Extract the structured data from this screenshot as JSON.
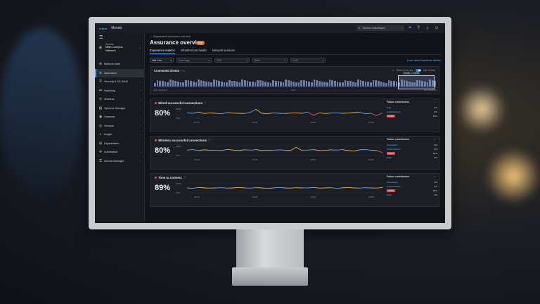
{
  "topbar": {
    "logo": "cisco",
    "app_name": "Meraki",
    "search_placeholder": "Search Dashboard",
    "icons": [
      "sparkle-icon",
      "help-icon",
      "bell-icon",
      "user-icon"
    ]
  },
  "sidebar": {
    "network_label": "Network",
    "network_value": "Main Campus Network",
    "items": [
      {
        "label": "Network-wide",
        "icon": "network-icon"
      },
      {
        "label": "Assurance",
        "icon": "assurance-icon",
        "active": true
      },
      {
        "label": "Security & SD-WAN",
        "icon": "security-icon"
      },
      {
        "label": "Switching",
        "icon": "switch-icon"
      },
      {
        "label": "Wireless",
        "icon": "wireless-icon"
      },
      {
        "label": "Systems Manager",
        "icon": "systems-icon"
      },
      {
        "label": "Cameras",
        "icon": "camera-icon"
      },
      {
        "label": "Sensors",
        "icon": "sensor-icon"
      },
      {
        "label": "Insight",
        "icon": "insight-icon"
      },
      {
        "label": "Organization",
        "icon": "org-icon"
      },
      {
        "label": "Automation",
        "icon": "automation-icon"
      },
      {
        "label": "Access Manager",
        "icon": "access-icon"
      }
    ]
  },
  "main": {
    "breadcrumb": "← Organization Assurance overview",
    "title": "Assurance overview",
    "badge": "Beta",
    "tabs": [
      "Experience metrics",
      "Infrastructure health",
      "Network services"
    ],
    "filters": [
      "Last 2 hrs",
      "Select tags",
      "SSID",
      "Band",
      "VLAN"
    ],
    "learn_link": "Learn about Experience Metrics",
    "connected_clients": {
      "title": "Connected clients",
      "right_label": "Restrict time app",
      "toggle_label": "Auto refresh",
      "selection": "13:40 — 13:53",
      "axis_start": "Nov 10 23:30",
      "axis_mid": "6:00",
      "axis_end": "Nov 10 23:59"
    },
    "metrics": [
      {
        "title": "Wired successful connections",
        "value": "80%",
        "y_top": "100%",
        "y_bottom": "75%",
        "ticks": [
          "23:40",
          "23:45",
          "23:50",
          "23:55"
        ],
        "contrib_title": "Failure contributors",
        "contributors": [
          {
            "name": "PoE",
            "value": "5%",
            "red": false
          },
          {
            "name": "Authentication",
            "value": "3%",
            "red": false
          },
          {
            "name": "DHCP",
            "value": "82%",
            "red": true
          }
        ],
        "series": [
          0.55,
          0.5,
          0.62,
          0.48,
          0.55,
          0.5,
          0.45,
          0.58,
          0.52,
          0.5,
          0.48,
          0.6,
          0.9,
          0.5,
          0.45,
          0.55,
          0.5,
          0.48,
          0.52,
          0.55,
          0.5,
          0.62,
          0.3,
          0.55,
          0.48,
          0.52,
          0.55,
          0.5,
          0.52,
          0.58,
          0.6,
          0.45,
          0.5,
          0.25,
          0.55
        ]
      },
      {
        "title": "Wireless successful connections",
        "value": "80%",
        "y_top": "100%",
        "y_bottom": "75%",
        "ticks": [
          "23:40",
          "23:45",
          "23:50",
          "23:55"
        ],
        "contrib_title": "Failure contributors",
        "contributors": [
          {
            "name": "Association",
            "value": "5%",
            "red": false
          },
          {
            "name": "Authentication",
            "value": "5%",
            "red": false
          },
          {
            "name": "DHCP",
            "value": "82%",
            "red": true
          },
          {
            "name": "DNS",
            "value": "5%",
            "red": false
          }
        ],
        "series": [
          0.55,
          0.6,
          0.5,
          0.58,
          0.52,
          0.55,
          0.5,
          0.62,
          0.55,
          0.5,
          0.58,
          0.55,
          0.6,
          0.5,
          0.55,
          0.52,
          0.58,
          0.55,
          0.5,
          0.85,
          0.5,
          0.55,
          0.6,
          0.5,
          0.52,
          0.58,
          0.55,
          0.6,
          0.5,
          0.45,
          0.58,
          0.6,
          0.55,
          0.5,
          0.3
        ]
      },
      {
        "title": "Time to connect",
        "value": "89%",
        "y_top": "100%",
        "y_bottom": "75%",
        "ticks": [
          "23:40",
          "23:45",
          "23:50",
          "23:55"
        ],
        "contrib_title": "Failure contributors",
        "contributors": [
          {
            "name": "Association",
            "value": "5%",
            "red": false
          },
          {
            "name": "Authentication",
            "value": "5%",
            "red": false
          },
          {
            "name": "DHCP",
            "value": "80%",
            "red": true
          },
          {
            "name": "DNS",
            "value": "5%",
            "red": false
          }
        ],
        "series": [
          0.5,
          0.45,
          0.55,
          0.5,
          0.48,
          0.5,
          0.52,
          0.48,
          0.5,
          0.55,
          0.5,
          0.48,
          0.52,
          0.5,
          0.45,
          0.5,
          0.55,
          0.5,
          0.48,
          0.52,
          0.5,
          0.5,
          0.55,
          0.48,
          0.5,
          0.52,
          0.45,
          0.5,
          0.55,
          0.5,
          0.48,
          0.52,
          0.5,
          0.48,
          0.55
        ]
      }
    ]
  }
}
